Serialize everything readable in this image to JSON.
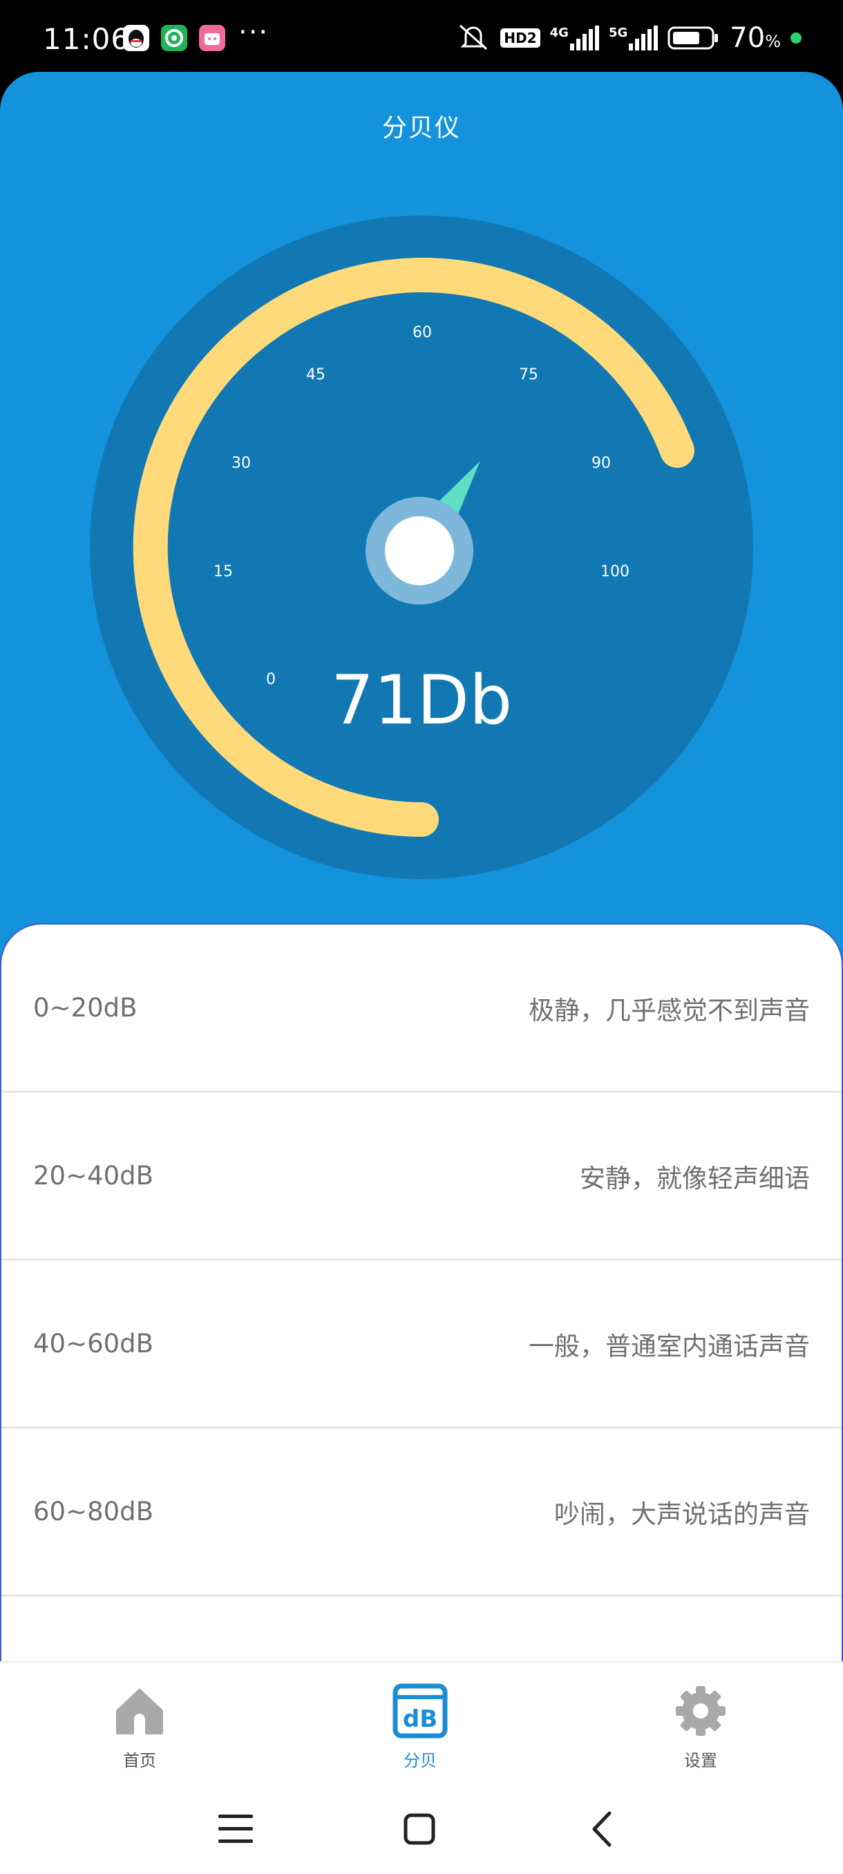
{
  "status_bar": {
    "time": "11:06",
    "more": "···",
    "hd_badge": "HD2",
    "net1": "4G",
    "net2": "5G",
    "battery_pct": "70",
    "battery_unit": "%",
    "icons": [
      "qq-icon",
      "browser-icon",
      "pink-app-icon",
      "mute-icon",
      "signal-icon",
      "battery-icon",
      "dot-icon"
    ]
  },
  "header": {
    "title": "分贝仪"
  },
  "gauge": {
    "reading_text": "71Db",
    "value": 71,
    "ticks": [
      "0",
      "15",
      "30",
      "45",
      "60",
      "75",
      "90",
      "100"
    ],
    "arc_color": "#FFDA7A",
    "dial_color": "#1178B4",
    "needle_color": "#5EDFC4"
  },
  "levels": [
    {
      "range": "0~20dB",
      "desc": "极静，几乎感觉不到声音"
    },
    {
      "range": "20~40dB",
      "desc": "安静，就像轻声细语"
    },
    {
      "range": "40~60dB",
      "desc": "一般，普通室内通话声音"
    },
    {
      "range": "60~80dB",
      "desc": "吵闹，大声说话的声音"
    },
    {
      "range": "",
      "desc": ""
    }
  ],
  "bottom_nav": {
    "items": [
      {
        "label": "首页",
        "icon": "home-icon"
      },
      {
        "label": "分贝",
        "icon": "db-icon",
        "active": true
      },
      {
        "label": "设置",
        "icon": "gear-icon"
      }
    ]
  },
  "system_nav": [
    "menu-icon",
    "home-square-icon",
    "back-icon"
  ]
}
